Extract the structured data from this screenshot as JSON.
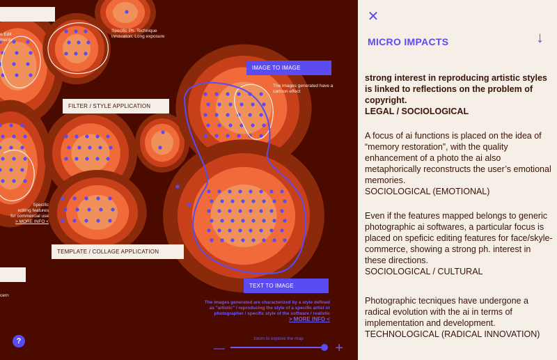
{
  "map": {
    "labels": [
      {
        "id": "image-to-image",
        "text": "IMAGE TO IMAGE",
        "style": "blue"
      },
      {
        "id": "filter-style",
        "text": "FILTER / STYLE APPLICATION",
        "style": "light"
      },
      {
        "id": "template-collage",
        "text": "TEMPLATE / COLLAGE APPLICATION",
        "style": "light"
      },
      {
        "id": "text-to-image",
        "text": "TEXT TO IMAGE",
        "style": "blue"
      }
    ],
    "notes": {
      "edit_partial": "e Edit\nments",
      "specific_ph_technique": "Specific Ph. Technique\ninnovation: Long exposure",
      "cartoon_effect": "The images generated have a\ncartoon effect",
      "specific_editing": "Specific\nediting features\nfor commercial use",
      "specific_editing_more": "> MORE INFO <",
      "artistic_style": "The images generated are characterized by a style defined\nas \"artistic\" / reproducing the style of a specific artist or\nphotographer / specific style of the software / realistic",
      "artistic_more": "> MORE INFO <",
      "cern_partial": "cern"
    },
    "zoom_hint": "zoom to explore the map",
    "zoom_minus": "—",
    "zoom_plus": "+",
    "help": "?"
  },
  "panel": {
    "close_icon": "✕",
    "title": "MICRO IMPACTS",
    "down_icon": "↓",
    "blocks": [
      {
        "text": "strong interest in reproducing artistic styles is linked to reflections on the problem of copyright.",
        "tag": "LEGAL / SOCIOLOGICAL",
        "bold": true
      },
      {
        "text": "A focus of ai functions is placed on the idea of “memory restoration”, with the quality enhancement of a photo the ai also metaphorically reconstructs the user’s emotional memories.",
        "tag": "SOCIOLOGICAL (EMOTIONAL)",
        "bold": false
      },
      {
        "text": "Even if the features mapped belongs to generic photographic ai softwares, a particular focus is placed on speficic editing features for face/skyle-commerce, showing a strong ph. interest in these directions.",
        "tag": "SOCIOLOGICAL / CULTURAL",
        "bold": false
      },
      {
        "text": "Photographic tecniques have undergone a radical evolution with the ai in terms of implementation and development.",
        "tag": "TECHNOLOGICAL (RADICAL INNOVATION)",
        "bold": false
      }
    ]
  },
  "colors": {
    "background": "#4a0a00",
    "panel": "#f6efe7",
    "accent": "#5a4cf0",
    "blob_outer": "#8a2a0a",
    "blob_mid": "#c8401a",
    "blob_inner": "#f06a3a",
    "blob_core": "#f0905a"
  }
}
